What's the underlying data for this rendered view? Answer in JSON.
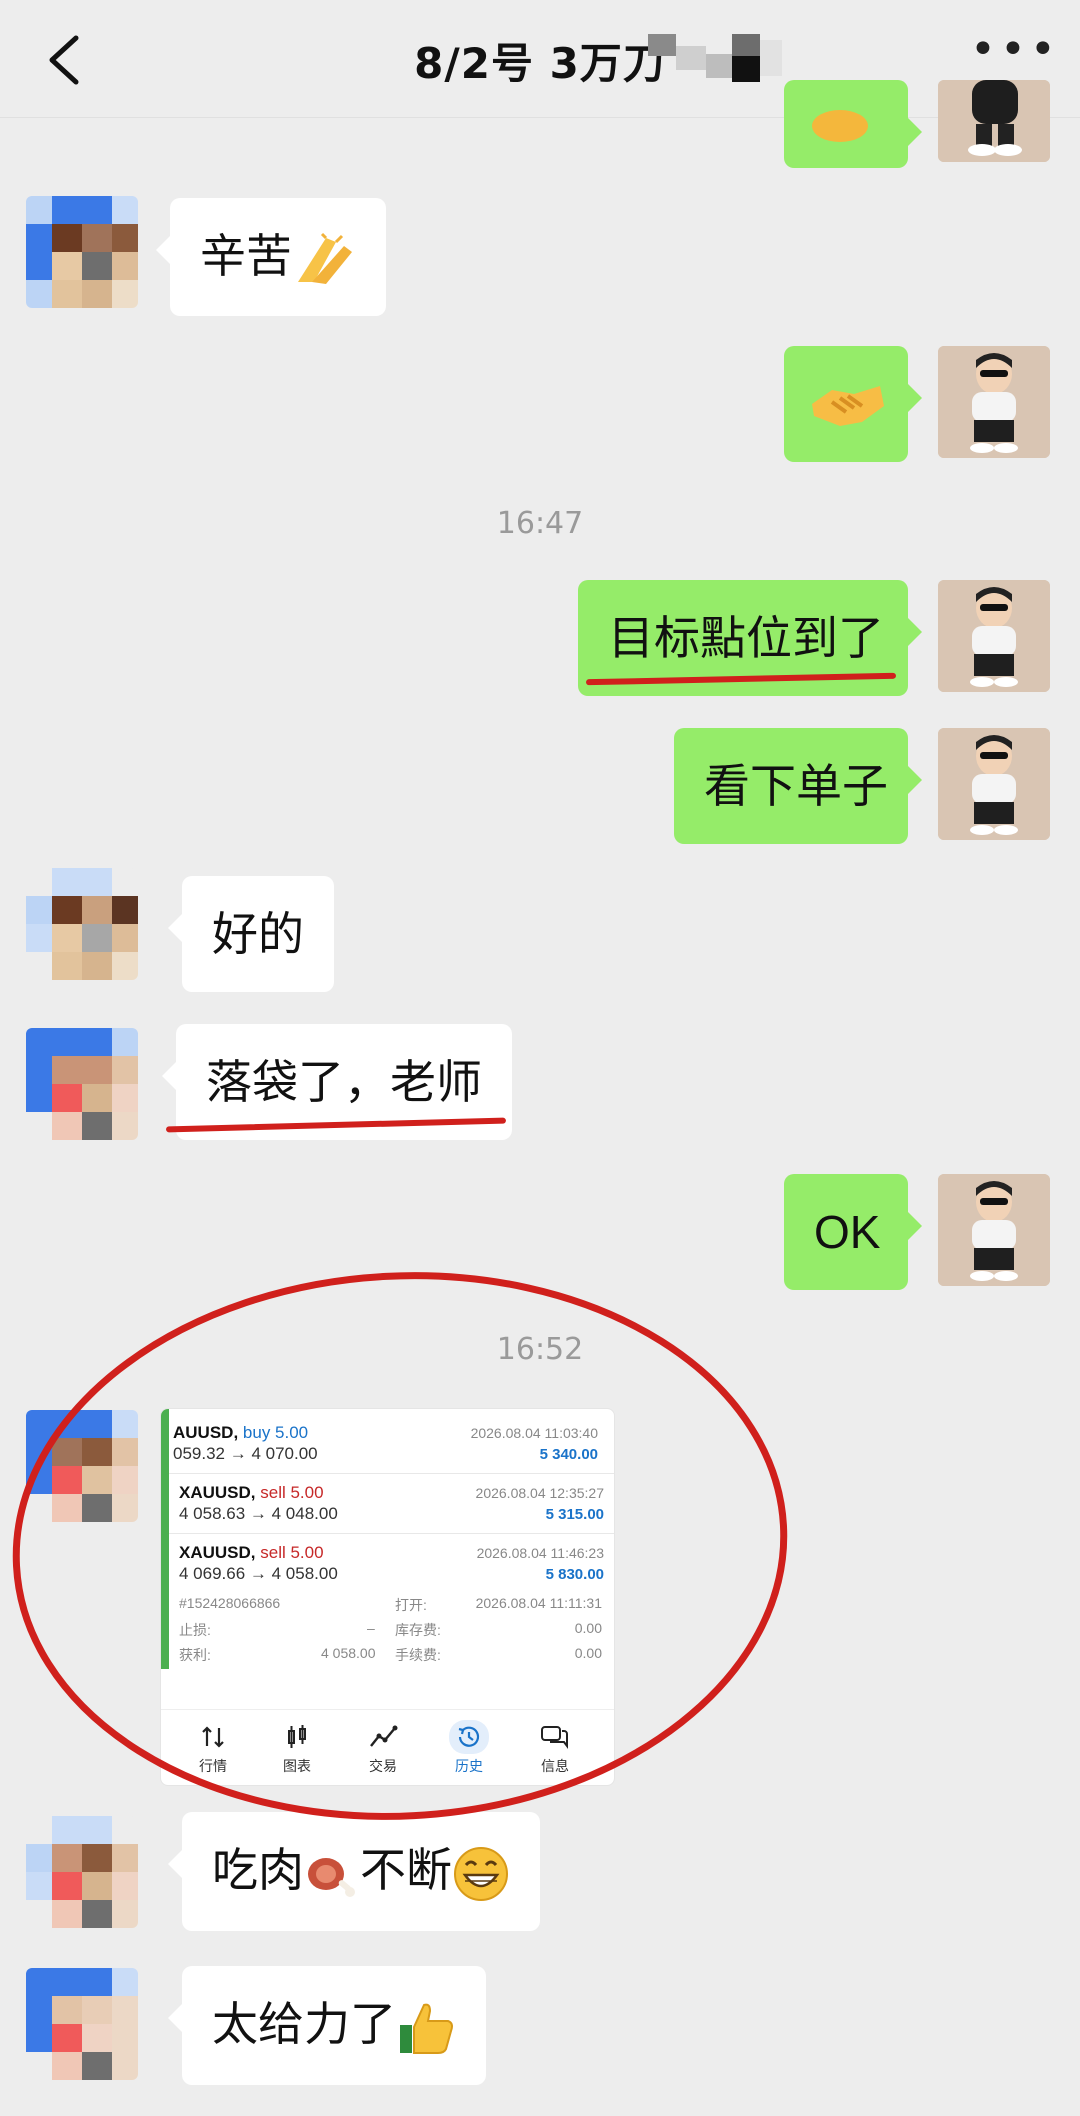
{
  "header": {
    "title": "8/2号  3万刀"
  },
  "timestamps": [
    "16:47",
    "16:52"
  ],
  "messages": {
    "m1": "辛苦",
    "m3": "目标點位到了",
    "m4": "看下单子",
    "m5": "好的",
    "m6": "落袋了，老师",
    "m7": "OK",
    "m8": "吃肉",
    "m8b": "不断",
    "m9": "太给力了"
  },
  "trade_card": {
    "trades": [
      {
        "symbol": "AUUSD, ",
        "dir": "buy 5.00",
        "prices": "059.32 → 4 070.00",
        "datetime": "2026.08.04 11:03:40",
        "profit": "5 340.00"
      },
      {
        "symbol": "XAUUSD, ",
        "dir": "sell 5.00",
        "prices": "4 058.63 → 4 048.00",
        "datetime": "2026.08.04 12:35:27",
        "profit": "5 315.00"
      },
      {
        "symbol": "XAUUSD, ",
        "dir": "sell 5.00",
        "prices": "4 069.66 → 4 058.00",
        "datetime": "2026.08.04 11:46:23",
        "profit": "5 830.00"
      }
    ],
    "order_id": "#152428066866",
    "open_label": "打开:",
    "open_time": "2026.08.04 11:11:31",
    "sl_label": "止损:",
    "sl_value": "–",
    "swap_label": "库存费:",
    "swap_value": "0.00",
    "tp_label": "获利:",
    "tp_value": "4 058.00",
    "fee_label": "手续费:",
    "fee_value": "0.00",
    "tabs": [
      "行情",
      "图表",
      "交易",
      "历史",
      "信息"
    ],
    "active_tab": "历史"
  },
  "colors": {
    "outgoing_bubble": "#95ec69",
    "incoming_bubble": "#ffffff",
    "annotation_red": "#d0201c",
    "background": "#ededed"
  }
}
